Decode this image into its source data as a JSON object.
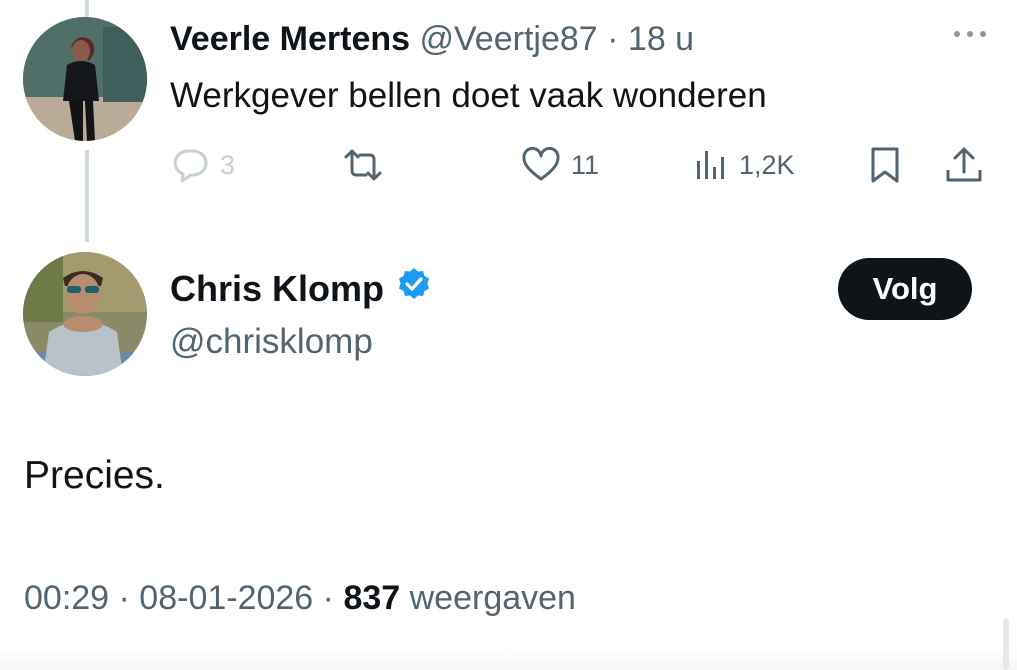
{
  "reply_tweet": {
    "name": "Veerle Mertens",
    "handle": "@Veertje87",
    "separator": "·",
    "time": "18 u",
    "text": "Werkgever bellen doet vaak wonderen",
    "actions": {
      "replies": "3",
      "likes": "11",
      "views": "1,2K"
    },
    "icons": [
      "reply-icon",
      "retweet-icon",
      "like-icon",
      "views-icon",
      "bookmark-icon",
      "share-icon",
      "more-icon"
    ]
  },
  "main_tweet": {
    "name": "Chris Klomp",
    "verified": true,
    "handle": "@chrisklomp",
    "follow_label": "Volg",
    "text": "Precies.",
    "timestamp": "00:29 · 08-01-2026 · ",
    "views_count": "837",
    "views_label": "weergaven"
  },
  "colors": {
    "text": "#0f1419",
    "secondary": "#536471",
    "verified_blue": "#1d9bf0",
    "thread_line": "#cfd9de"
  }
}
